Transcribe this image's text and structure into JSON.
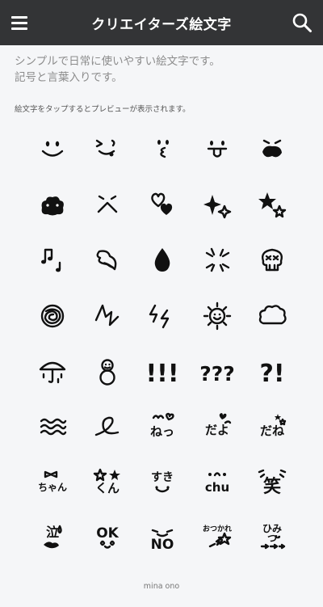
{
  "header": {
    "title": "クリエイターズ絵文字",
    "menu_icon": "hamburger-menu-icon",
    "search_icon": "search-icon",
    "background": "#333436"
  },
  "description": {
    "line1": "シンプルで日常に使いやすい絵文字です。",
    "line2": "記号と言葉入りです。"
  },
  "hint": "絵文字をタップするとプレビューが表示されます。",
  "emojis": [
    {
      "name": "smile-face-emoji"
    },
    {
      "name": "wink-tongue-face-emoji"
    },
    {
      "name": "side-face-emoji"
    },
    {
      "name": "tongue-out-face-emoji"
    },
    {
      "name": "upset-face-emoji"
    },
    {
      "name": "puffed-cheeks-emoji"
    },
    {
      "name": "frown-face-emoji"
    },
    {
      "name": "hearts-emoji"
    },
    {
      "name": "sparkles-emoji"
    },
    {
      "name": "stars-emoji"
    },
    {
      "name": "music-notes-emoji"
    },
    {
      "name": "sweat-drop-emoji"
    },
    {
      "name": "water-drop-emoji"
    },
    {
      "name": "anger-mark-emoji"
    },
    {
      "name": "skull-emoji"
    },
    {
      "name": "scribble-ball-emoji"
    },
    {
      "name": "zigzag-emoji"
    },
    {
      "name": "lightning-emoji"
    },
    {
      "name": "sun-face-emoji"
    },
    {
      "name": "cloud-emoji"
    },
    {
      "name": "umbrella-rain-emoji"
    },
    {
      "name": "snowman-emoji"
    },
    {
      "name": "exclamation-emoji",
      "text": "!!!"
    },
    {
      "name": "question-marks-emoji",
      "text": "???"
    },
    {
      "name": "interrobang-emoji",
      "text": "?!"
    },
    {
      "name": "waves-emoji"
    },
    {
      "name": "curl-emoji"
    },
    {
      "name": "nee-emoji",
      "text": "ねっ"
    },
    {
      "name": "dayo-emoji",
      "text": "だよ"
    },
    {
      "name": "dane-emoji",
      "text": "だね"
    },
    {
      "name": "chan-emoji",
      "text": "ちゃん"
    },
    {
      "name": "kun-emoji",
      "text": "くん"
    },
    {
      "name": "suki-emoji",
      "text": "すき"
    },
    {
      "name": "chu-emoji",
      "text": "chu"
    },
    {
      "name": "laugh-emoji",
      "text": "笑"
    },
    {
      "name": "cry-emoji",
      "text": "泣"
    },
    {
      "name": "ok-emoji",
      "text": "OK"
    },
    {
      "name": "no-emoji",
      "text": "NO"
    },
    {
      "name": "otsukare-emoji",
      "text": "おつかれ"
    },
    {
      "name": "himitsu-emoji",
      "text": "ひみつ"
    }
  ],
  "footer": "mina ono"
}
